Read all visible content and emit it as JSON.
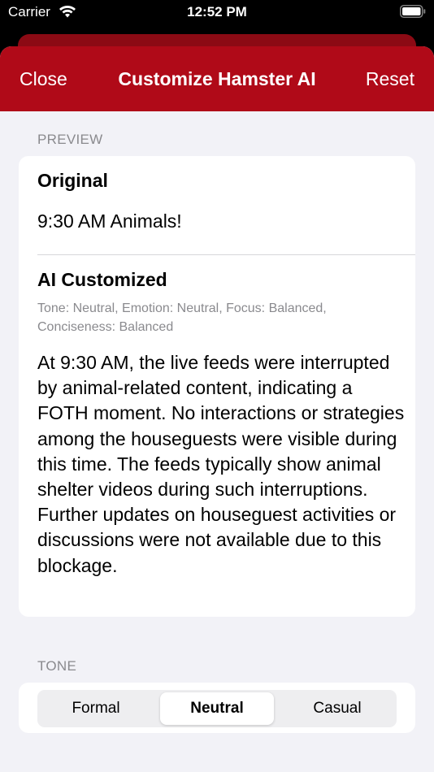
{
  "status_bar": {
    "carrier": "Carrier",
    "time": "12:52 PM",
    "icons": [
      "wifi-icon",
      "battery-icon"
    ]
  },
  "nav": {
    "close_label": "Close",
    "title": "Customize Hamster AI",
    "reset_label": "Reset",
    "color": "#b00a18"
  },
  "preview": {
    "header": "PREVIEW",
    "original_title": "Original",
    "original_text": "9:30 AM Animals!",
    "ai_title": "AI Customized",
    "ai_meta": "Tone: Neutral, Emotion: Neutral, Focus: Balanced, Conciseness: Balanced",
    "ai_body": "At 9:30 AM, the live feeds were interrupted by animal-related content, indicating a FOTH moment. No interactions or strategies among the houseguests were visible during this time. The feeds typically show animal shelter videos during such interruptions. Further updates on houseguest activities or discussions were not available due to this blockage."
  },
  "tone": {
    "header": "TONE",
    "options": [
      "Formal",
      "Neutral",
      "Casual"
    ],
    "selected": "Neutral"
  }
}
